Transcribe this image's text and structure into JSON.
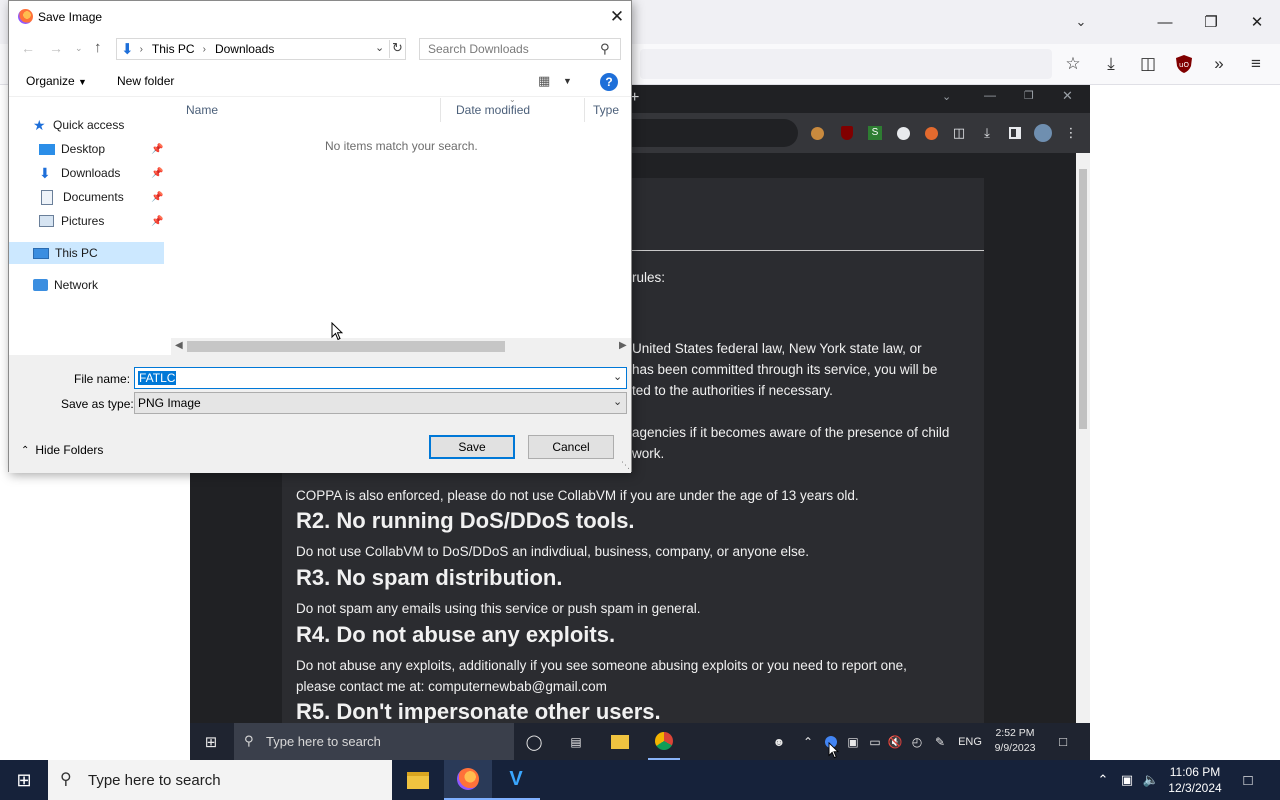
{
  "colors": {
    "accent": "#0078d7",
    "selection": "#0078d7",
    "host_taskbar": "#16223a",
    "dark_page": "#202124"
  },
  "dialog": {
    "title": "Save Image",
    "icon": "firefox-icon",
    "breadcrumb": [
      "This PC",
      "Downloads"
    ],
    "search_placeholder": "Search Downloads",
    "toolbar": {
      "organize": "Organize",
      "new_folder": "New folder",
      "help": "?"
    },
    "nav": {
      "quick_access": "Quick access",
      "desktop": "Desktop",
      "downloads": "Downloads",
      "documents": "Documents",
      "pictures": "Pictures",
      "this_pc": "This PC",
      "network": "Network"
    },
    "columns": {
      "name": "Name",
      "date_modified": "Date modified",
      "type": "Type"
    },
    "empty_message": "No items match your search.",
    "file_name_label": "File name:",
    "file_name_value": "FATLC",
    "save_as_type_label": "Save as type:",
    "save_as_type_value": "PNG Image",
    "hide_folders": "Hide Folders",
    "save_button": "Save",
    "cancel_button": "Cancel"
  },
  "vm_page": {
    "heading_fragment": "rules:",
    "rule1_line1": "United States federal law, New York state law, or",
    "rule1_line2": "has been committed through its service, you will be",
    "rule1_line3": "ted to the authorities if necessary.",
    "rule1_line4": "agencies if it becomes aware of the presence of child",
    "rule1_line5": "work.",
    "coppa": "COPPA is also enforced, please do not use CollabVM if you are under the age of 13 years old.",
    "r2_title": "R2. No running DoS/DDoS tools.",
    "r2_text": "Do not use CollabVM to DoS/DDoS an indivdiual, business, company, or anyone else.",
    "r3_title": "R3. No spam distribution.",
    "r3_text": "Do not spam any emails using this service or push spam in general.",
    "r4_title": "R4. Do not abuse any exploits.",
    "r4_text1": "Do not abuse any exploits, additionally if you see someone abusing exploits or you need to report one,",
    "r4_text2": "please contact me at: computernewbab@gmail.com",
    "r5_title": "R5. Don't impersonate other users."
  },
  "vm_taskbar": {
    "search_placeholder": "Type here to search",
    "language": "ENG",
    "time": "2:52 PM",
    "date": "9/9/2023"
  },
  "host_taskbar": {
    "search_placeholder": "Type here to search",
    "time": "11:06 PM",
    "date": "12/3/2024"
  }
}
